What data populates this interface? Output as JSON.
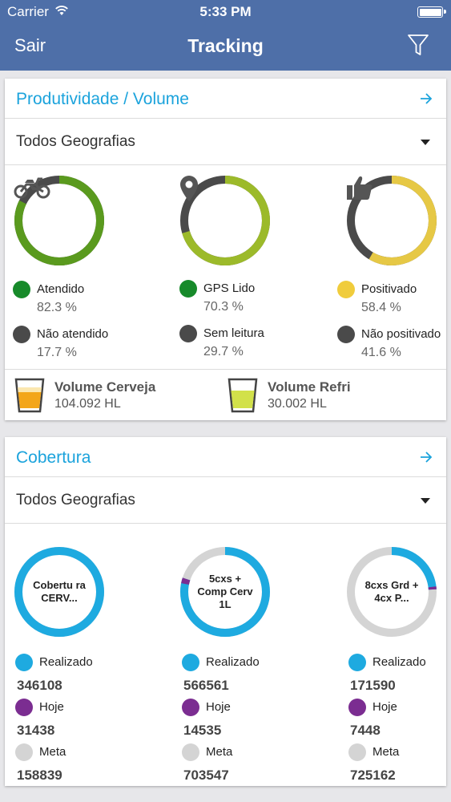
{
  "status_bar": {
    "carrier": "Carrier",
    "time": "5:33 PM"
  },
  "nav": {
    "back_label": "Sair",
    "title": "Tracking"
  },
  "colors": {
    "nav_bg": "#4e6fa8",
    "accent": "#1ba3dc",
    "green": "#5a9a1e",
    "lime": "#9cba2a",
    "yellow": "#e6c845",
    "track_dark": "#4a4a4a",
    "blue": "#1eaae0",
    "purple": "#7b2d91",
    "gray": "#d4d4d4"
  },
  "productivity": {
    "title": "Produtividade / Volume",
    "geo_filter": "Todos Geografias",
    "rings": [
      {
        "icon": "motorcycle-icon",
        "fraction": 0.823,
        "color": "#5a9a1e",
        "legend": [
          {
            "label": "Atendido",
            "value": "82.3 %",
            "color": "#178a2a"
          },
          {
            "label": "Não atendido",
            "value": "17.7 %",
            "color": "#4a4a4a"
          }
        ]
      },
      {
        "icon": "location-pin-icon",
        "fraction": 0.703,
        "color": "#9cba2a",
        "legend": [
          {
            "label": "GPS Lido",
            "value": "70.3 %",
            "color": "#178a2a"
          },
          {
            "label": "Sem leitura",
            "value": "29.7 %",
            "color": "#4a4a4a"
          }
        ]
      },
      {
        "icon": "thumbs-up-icon",
        "fraction": 0.584,
        "color": "#e6c845",
        "legend": [
          {
            "label": "Positivado",
            "value": "58.4 %",
            "color": "#f0cc3c"
          },
          {
            "label": "Não positivado",
            "value": "41.6 %",
            "color": "#4a4a4a"
          }
        ]
      }
    ],
    "volumes": [
      {
        "title": "Volume Cerveja",
        "value": "104.092 HL",
        "icon": "beer-glass-icon"
      },
      {
        "title": "Volume Refri",
        "value": "30.002 HL",
        "icon": "soda-glass-icon"
      }
    ]
  },
  "coverage": {
    "title": "Cobertura",
    "geo_filter": "Todos Geografias",
    "rings": [
      {
        "label": "Cobertu ra CERV...",
        "realizado_fraction": 1.0,
        "hoje_fraction": 0.0,
        "legend": [
          {
            "label": "Realizado",
            "value": "346108",
            "color": "#1eaae0"
          },
          {
            "label": "Hoje",
            "value": "31438",
            "color": "#7b2d91"
          },
          {
            "label": "Meta",
            "value": "158839",
            "color": "#d4d4d4"
          }
        ]
      },
      {
        "label": "5cxs + Comp Cerv 1L",
        "realizado_fraction": 0.8,
        "hoje_fraction": 0.02,
        "legend": [
          {
            "label": "Realizado",
            "value": "566561",
            "color": "#1eaae0"
          },
          {
            "label": "Hoje",
            "value": "14535",
            "color": "#7b2d91"
          },
          {
            "label": "Meta",
            "value": "703547",
            "color": "#d4d4d4"
          }
        ]
      },
      {
        "label": "8cxs Grd + 4cx P...",
        "realizado_fraction": 0.24,
        "hoje_fraction": 0.01,
        "legend": [
          {
            "label": "Realizado",
            "value": "171590",
            "color": "#1eaae0"
          },
          {
            "label": "Hoje",
            "value": "7448",
            "color": "#7b2d91"
          },
          {
            "label": "Meta",
            "value": "725162",
            "color": "#d4d4d4"
          }
        ]
      }
    ]
  }
}
